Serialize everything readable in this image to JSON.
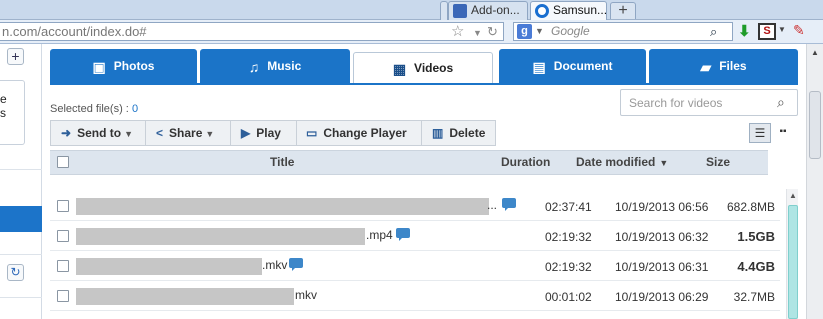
{
  "browser": {
    "tabs": [
      {
        "label": "Add-on...",
        "icon": "puzzle-icon"
      },
      {
        "label": "Samsun...",
        "icon": "samsung-icon"
      }
    ],
    "new_tab_symbol": "+",
    "url": "n.com/account/index.do#",
    "search_engine_letter": "g",
    "search_placeholder": "Google"
  },
  "sidebar": {
    "add_symbol": "+",
    "snippet_line1": "e",
    "snippet_line2": "s",
    "refresh_symbol": "↻"
  },
  "media_tabs": [
    {
      "label": "Photos",
      "icon": "photo-icon"
    },
    {
      "label": "Music",
      "icon": "music-icon"
    },
    {
      "label": "Videos",
      "icon": "film-icon",
      "active": true
    },
    {
      "label": "Document",
      "icon": "document-icon"
    },
    {
      "label": "Files",
      "icon": "folder-icon"
    }
  ],
  "selection": {
    "label": "Selected file(s) :",
    "count": "0"
  },
  "video_search": {
    "placeholder": "Search for videos"
  },
  "toolbar": {
    "send_to": "Send to",
    "share": "Share",
    "play": "Play",
    "change_player": "Change Player",
    "delete": "Delete"
  },
  "table": {
    "headers": {
      "title": "Title",
      "duration": "Duration",
      "date_modified": "Date modified",
      "size": "Size"
    },
    "rows": [
      {
        "ext": "...",
        "duration": "02:37:41",
        "date": "10/19/2013 06:56",
        "size": "682.8MB",
        "size_bold": false,
        "has_note": true
      },
      {
        "ext": ".mp4",
        "duration": "02:19:32",
        "date": "10/19/2013 06:32",
        "size": "1.5GB",
        "size_bold": true,
        "has_note": true
      },
      {
        "ext": ".mkv",
        "duration": "02:19:32",
        "date": "10/19/2013 06:31",
        "size": "4.4GB",
        "size_bold": true,
        "has_note": true
      },
      {
        "ext": "mkv",
        "duration": "00:01:02",
        "date": "10/19/2013 06:29",
        "size": "32.7MB",
        "size_bold": false,
        "has_note": false
      }
    ]
  },
  "colors": {
    "accent": "#1b74c8",
    "header_bg": "#dde5ee",
    "scroll_thumb": "#aee5e4"
  }
}
